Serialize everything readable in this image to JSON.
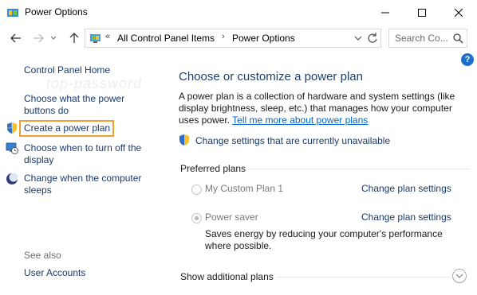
{
  "window": {
    "title": "Power Options",
    "icon": "power-options-icon"
  },
  "nav": {
    "address_prefix": "«",
    "breadcrumb": [
      "All Control Panel Items",
      "Power Options"
    ],
    "separator": "›",
    "search_placeholder": "Search Co..."
  },
  "left_pane": {
    "watermark": "top-password",
    "links": [
      {
        "label": "Control Panel Home"
      },
      {
        "label": "Choose what the power buttons do"
      },
      {
        "label": "Create a power plan",
        "icon": "shield-icon"
      },
      {
        "label": "Choose when to turn off the display",
        "icon": "monitor-clock-icon"
      },
      {
        "label": "Change when the computer sleeps",
        "icon": "moon-icon"
      }
    ],
    "see_also": "See also",
    "see_also_links": [
      {
        "label": "User Accounts"
      }
    ]
  },
  "main": {
    "help": "?",
    "title": "Choose or customize a power plan",
    "description": "A power plan is a collection of hardware and system settings (like display brightness, sleep, etc.) that manages how your computer uses power.",
    "description_link": "Tell me more about power plans",
    "change_unavailable": "Change settings that are currently unavailable",
    "preferred_header": "Preferred plans",
    "plans": [
      {
        "name": "My Custom Plan 1",
        "change": "Change plan settings",
        "selected": false
      },
      {
        "name": "Power saver",
        "change": "Change plan settings",
        "selected": true,
        "description": "Saves energy by reducing your computer's performance where possible."
      }
    ],
    "show_additional": "Show additional plans"
  },
  "colors": {
    "link": "#1a3a6e",
    "title": "#1f3f6e",
    "highlight": "#f0a030"
  }
}
